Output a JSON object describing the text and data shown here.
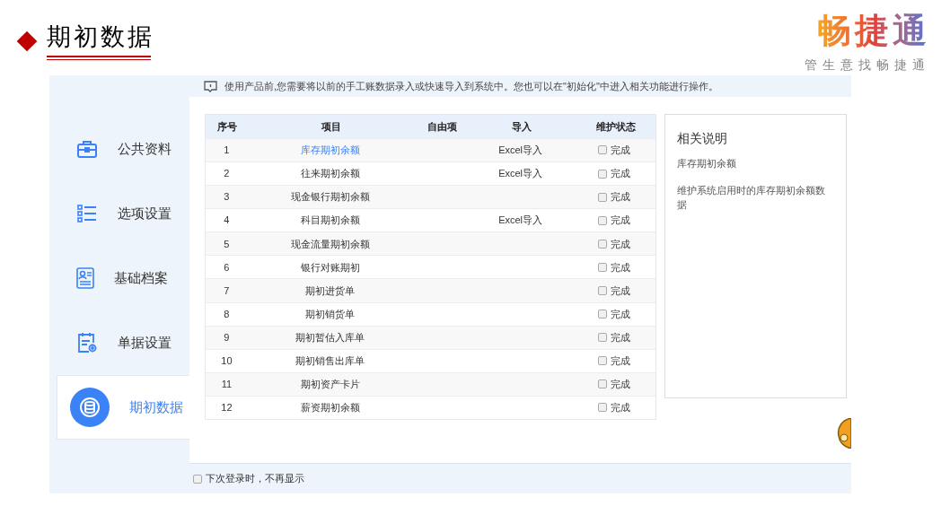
{
  "slide_title": "期初数据",
  "logo": {
    "name": "畅捷通",
    "tagline": "管生意找畅捷通"
  },
  "notice": "使用产品前,您需要将以前的手工账数据录入或快速导入到系统中。您也可以在\"初始化\"中进入相关功能进行操作。",
  "sidebar": {
    "items": [
      {
        "label": "公共资料",
        "selected": false
      },
      {
        "label": "选项设置",
        "selected": false
      },
      {
        "label": "基础档案",
        "selected": false
      },
      {
        "label": "单据设置",
        "selected": false
      },
      {
        "label": "期初数据",
        "selected": true
      }
    ]
  },
  "table": {
    "columns": [
      "序号",
      "项目",
      "自由项",
      "导入",
      "维护状态"
    ],
    "rows": [
      {
        "no": "1",
        "item": "库存期初余额",
        "selected": true,
        "import": "Excel导入",
        "done": false,
        "status": "完成"
      },
      {
        "no": "2",
        "item": "往来期初余额",
        "selected": false,
        "import": "Excel导入",
        "done": false,
        "status": "完成"
      },
      {
        "no": "3",
        "item": "现金银行期初余额",
        "selected": false,
        "done": false,
        "status": "完成"
      },
      {
        "no": "4",
        "item": "科目期初余额",
        "selected": false,
        "import": "Excel导入",
        "done": false,
        "status": "完成"
      },
      {
        "no": "5",
        "item": "现金流量期初余额",
        "selected": false,
        "done": false,
        "status": "完成"
      },
      {
        "no": "6",
        "item": "银行对账期初",
        "selected": false,
        "done": false,
        "status": "完成"
      },
      {
        "no": "7",
        "item": "期初进货单",
        "selected": false,
        "done": false,
        "status": "完成"
      },
      {
        "no": "8",
        "item": "期初销货单",
        "selected": false,
        "done": false,
        "status": "完成"
      },
      {
        "no": "9",
        "item": "期初暂估入库单",
        "selected": false,
        "done": false,
        "status": "完成"
      },
      {
        "no": "10",
        "item": "期初销售出库单",
        "selected": false,
        "done": false,
        "status": "完成"
      },
      {
        "no": "11",
        "item": "期初资产卡片",
        "selected": false,
        "done": false,
        "status": "完成"
      },
      {
        "no": "12",
        "item": "薪资期初余额",
        "selected": false,
        "done": false,
        "status": "完成"
      }
    ]
  },
  "info_panel": {
    "title": "相关说明",
    "lines": [
      "库存期初余额",
      "维护系统启用时的库存期初余额数据"
    ]
  },
  "footer_option": {
    "label": "下次登录时，不再显示",
    "checked": false
  }
}
